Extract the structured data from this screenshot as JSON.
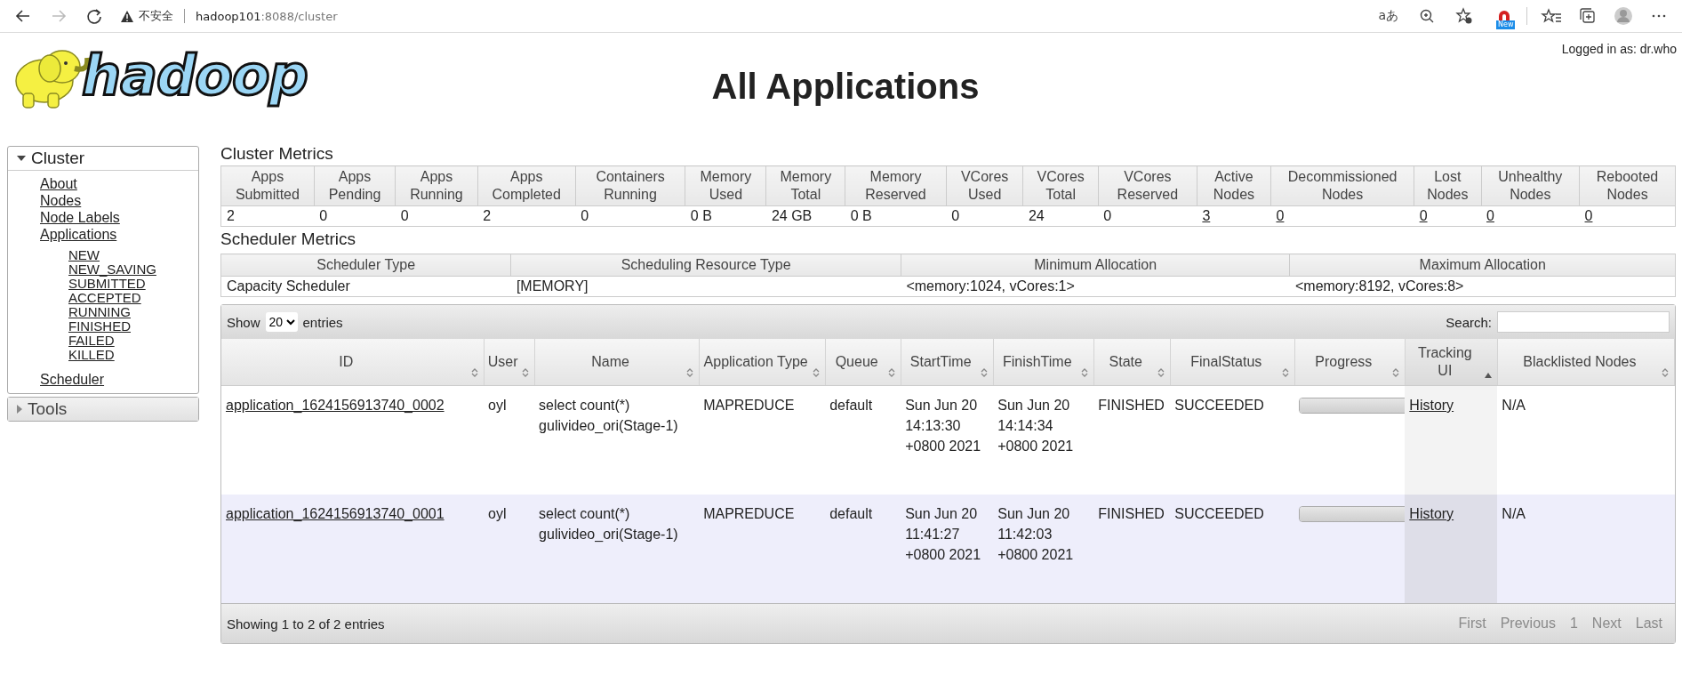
{
  "browser": {
    "security_label": "不安全",
    "url_host": "hadoop101",
    "url_rest": ":8088/cluster",
    "read_aloud": "aあ",
    "badge": "New"
  },
  "header": {
    "logo_text": "hadoop",
    "title": "All Applications",
    "logged_in": "Logged in as: dr.who"
  },
  "sidebar": [
    {
      "label": "Cluster",
      "expanded": true,
      "links": [
        {
          "label": "About"
        },
        {
          "label": "Nodes"
        },
        {
          "label": "Node Labels"
        },
        {
          "label": "Applications",
          "children": [
            {
              "label": "NEW"
            },
            {
              "label": "NEW_SAVING"
            },
            {
              "label": "SUBMITTED"
            },
            {
              "label": "ACCEPTED"
            },
            {
              "label": "RUNNING"
            },
            {
              "label": "FINISHED"
            },
            {
              "label": "FAILED"
            },
            {
              "label": "KILLED"
            }
          ]
        },
        {
          "label": "Scheduler"
        }
      ]
    },
    {
      "label": "Tools",
      "expanded": false
    }
  ],
  "cluster_metrics": {
    "title": "Cluster Metrics",
    "columns": [
      "Apps Submitted",
      "Apps Pending",
      "Apps Running",
      "Apps Completed",
      "Containers Running",
      "Memory Used",
      "Memory Total",
      "Memory Reserved",
      "VCores Used",
      "VCores Total",
      "VCores Reserved",
      "Active Nodes",
      "Decommissioned Nodes",
      "Lost Nodes",
      "Unhealthy Nodes",
      "Rebooted Nodes"
    ],
    "values": [
      {
        "text": "2",
        "link": false
      },
      {
        "text": "0",
        "link": false
      },
      {
        "text": "0",
        "link": false
      },
      {
        "text": "2",
        "link": false
      },
      {
        "text": "0",
        "link": false
      },
      {
        "text": "0 B",
        "link": false
      },
      {
        "text": "24 GB",
        "link": false
      },
      {
        "text": "0 B",
        "link": false
      },
      {
        "text": "0",
        "link": false
      },
      {
        "text": "24",
        "link": false
      },
      {
        "text": "0",
        "link": false
      },
      {
        "text": "3",
        "link": true
      },
      {
        "text": "0",
        "link": true
      },
      {
        "text": "0",
        "link": true
      },
      {
        "text": "0",
        "link": true
      },
      {
        "text": "0",
        "link": true
      }
    ]
  },
  "scheduler_metrics": {
    "title": "Scheduler Metrics",
    "columns": [
      "Scheduler Type",
      "Scheduling Resource Type",
      "Minimum Allocation",
      "Maximum Allocation"
    ],
    "values": [
      "Capacity Scheduler",
      "[MEMORY]",
      "<memory:1024, vCores:1>",
      "<memory:8192, vCores:8>"
    ]
  },
  "apps_table": {
    "show_label": "Show",
    "page_size": "20",
    "entries_label": "entries",
    "search_label": "Search:",
    "columns": [
      {
        "label": "ID",
        "sorted": false
      },
      {
        "label": "User",
        "sorted": false
      },
      {
        "label": "Name",
        "sorted": false
      },
      {
        "label": "Application Type",
        "sorted": false
      },
      {
        "label": "Queue",
        "sorted": false
      },
      {
        "label": "StartTime",
        "sorted": false
      },
      {
        "label": "FinishTime",
        "sorted": false
      },
      {
        "label": "State",
        "sorted": false
      },
      {
        "label": "FinalStatus",
        "sorted": false
      },
      {
        "label": "Progress",
        "sorted": false
      },
      {
        "label": "Tracking UI",
        "sorted": true
      },
      {
        "label": "Blacklisted Nodes",
        "sorted": false
      }
    ],
    "rows": [
      {
        "id": "application_1624156913740_0002",
        "user": "oyl",
        "name": "select count(*) gulivideo_ori(Stage-1)",
        "type": "MAPREDUCE",
        "queue": "default",
        "start": "Sun Jun 20 14:13:30 +0800 2021",
        "finish": "Sun Jun 20 14:14:34 +0800 2021",
        "state": "FINISHED",
        "final_status": "SUCCEEDED",
        "level": 1,
        "tracking": "History",
        "blacklisted": "N/A"
      },
      {
        "id": "application_1624156913740_0001",
        "user": "oyl",
        "name": "select count(*) gulivideo_ori(Stage-1)",
        "type": "MAPREDUCE",
        "queue": "default",
        "start": "Sun Jun 20 11:41:27 +0800 2021",
        "finish": "Sun Jun 20 11:42:03 +0800 2021",
        "state": "FINISHED",
        "final_status": "SUCCEEDED",
        "level": 1,
        "tracking": "History",
        "blacklisted": "N/A"
      }
    ],
    "info": "Showing 1 to 2 of 2 entries",
    "pager": [
      {
        "label": "First",
        "disabled": true
      },
      {
        "label": "Previous",
        "disabled": true
      },
      {
        "label": "1",
        "disabled": true
      },
      {
        "label": "Next",
        "disabled": true
      },
      {
        "label": "Last",
        "disabled": true
      }
    ]
  }
}
